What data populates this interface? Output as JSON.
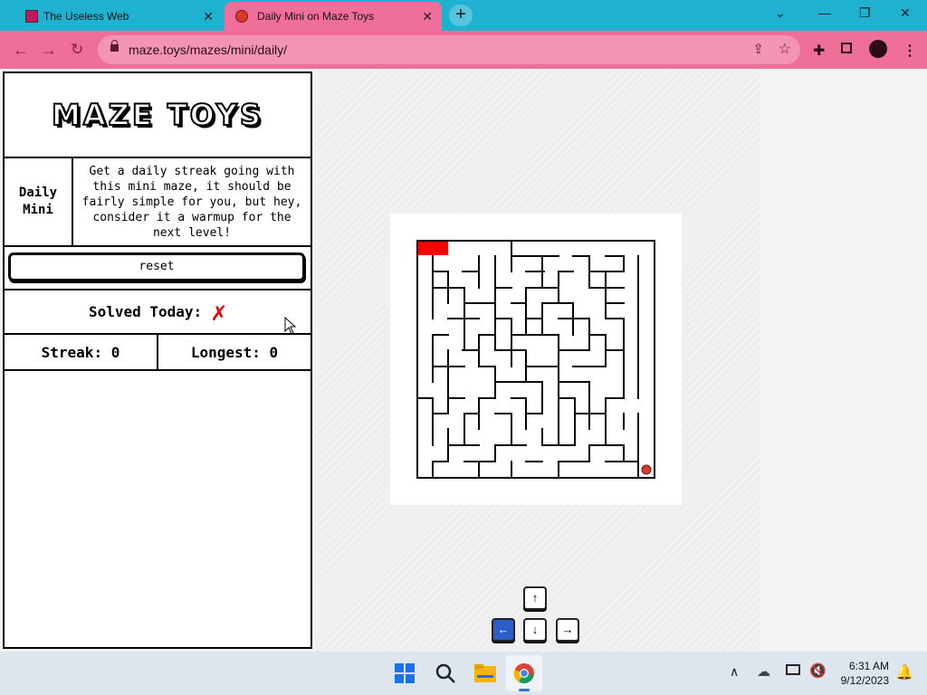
{
  "browser": {
    "tabs": [
      {
        "title": "The Useless Web",
        "favicon": "useless-web-icon",
        "active": false
      },
      {
        "title": "Daily Mini on Maze Toys",
        "favicon": "tomato-icon",
        "active": true
      }
    ],
    "url": "maze.toys/mazes/mini/daily/",
    "colors": {
      "tabbar": "#1fb2d0",
      "toolbar": "#f06f9a"
    }
  },
  "panel": {
    "logo": "MAZE TOYS",
    "mode_label": "Daily Mini",
    "description": "Get a daily streak going with this mini maze, it should be fairly simple for you, but hey, consider it a warmup for the next level!",
    "reset_label": "reset",
    "solved_label": "Solved Today:",
    "solved_mark": "✗",
    "streak_label": "Streak:",
    "streak_value": "0",
    "longest_label": "Longest:",
    "longest_value": "0"
  },
  "controls": {
    "up": "↑",
    "left": "←",
    "down": "↓",
    "right": "→"
  },
  "taskbar": {
    "time": "6:31 AM",
    "date": "9/12/2023"
  }
}
